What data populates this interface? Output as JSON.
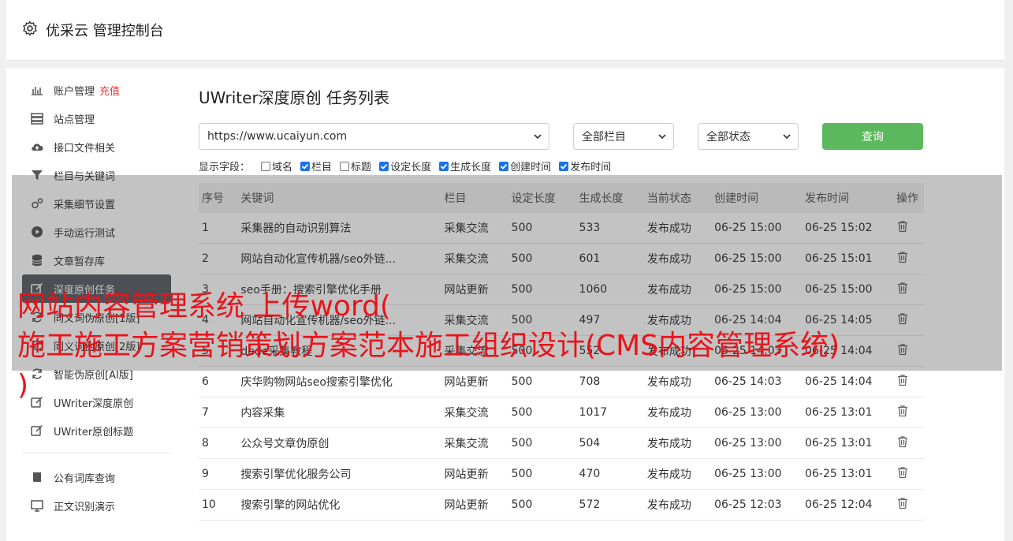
{
  "header": {
    "title": "优采云 管理控制台"
  },
  "sidebar": {
    "items": [
      {
        "label": "账户管理",
        "badge": "充值",
        "icon": "bar-chart-icon"
      },
      {
        "label": "站点管理",
        "icon": "server-icon"
      },
      {
        "label": "接口文件相关",
        "icon": "cloud-upload-icon"
      },
      {
        "label": "栏目与关键词",
        "icon": "filter-icon"
      },
      {
        "label": "采集细节设置",
        "icon": "cogs-icon"
      },
      {
        "label": "手动运行测试",
        "icon": "play-circle-icon"
      },
      {
        "label": "文章暂存库",
        "icon": "database-icon"
      },
      {
        "label": "深度原创任务",
        "icon": "edit-icon",
        "active": true
      },
      {
        "label": "同义词伪原创[1版]",
        "icon": "refresh-icon"
      },
      {
        "label": "同义词伪原创[2版]",
        "icon": "refresh-icon"
      },
      {
        "label": "智能伪原创[AI版]",
        "icon": "refresh-icon"
      },
      {
        "label": "UWriter深度原创",
        "icon": "edit-icon"
      },
      {
        "label": "UWriter原创标题",
        "icon": "edit-icon"
      }
    ],
    "items2": [
      {
        "label": "公有词库查询",
        "icon": "book-icon"
      },
      {
        "label": "正文识别演示",
        "icon": "monitor-icon"
      }
    ]
  },
  "main": {
    "title": "UWriter深度原创 任务列表",
    "site_select": "https://www.ucaiyun.com",
    "column_select": "全部栏目",
    "status_select": "全部状态",
    "query_label": "查询",
    "fields_label": "显示字段：",
    "fields": [
      {
        "label": "域名",
        "checked": false
      },
      {
        "label": "栏目",
        "checked": true
      },
      {
        "label": "标题",
        "checked": false
      },
      {
        "label": "设定长度",
        "checked": true
      },
      {
        "label": "生成长度",
        "checked": true
      },
      {
        "label": "创建时间",
        "checked": true
      },
      {
        "label": "发布时间",
        "checked": true
      }
    ],
    "columns": [
      "序号",
      "关键词",
      "栏目",
      "设定长度",
      "生成长度",
      "当前状态",
      "创建时间",
      "发布时间",
      "操作"
    ],
    "rows": [
      [
        "1",
        "采集器的自动识别算法",
        "采集交流",
        "500",
        "533",
        "发布成功",
        "06-25 15:00",
        "06-25 15:02"
      ],
      [
        "2",
        "网站自动化宣传机器/seo外链...",
        "采集交流",
        "500",
        "601",
        "发布成功",
        "06-25 15:00",
        "06-25 15:01"
      ],
      [
        "3",
        "seo手册：搜索引擎优化手册",
        "网站更新",
        "500",
        "1060",
        "发布成功",
        "06-25 15:00",
        "06-25 15:00"
      ],
      [
        "4",
        "网站自动化宣传机器/seo外链...",
        "采集交流",
        "500",
        "497",
        "发布成功",
        "06-25 14:04",
        "06-25 14:05"
      ],
      [
        "5",
        "dede采集教程",
        "采集交流",
        "500",
        "552",
        "发布成功",
        "06-25 14:03",
        "06-25 14:04"
      ],
      [
        "6",
        "庆华购物网站seo搜索引擎优化",
        "网站更新",
        "500",
        "708",
        "发布成功",
        "06-25 14:03",
        "06-25 14:04"
      ],
      [
        "7",
        "内容采集",
        "采集交流",
        "500",
        "1017",
        "发布成功",
        "06-25 13:00",
        "06-25 13:01"
      ],
      [
        "8",
        "公众号文章伪原创",
        "采集交流",
        "500",
        "504",
        "发布成功",
        "06-25 13:00",
        "06-25 13:01"
      ],
      [
        "9",
        "搜索引擎优化服务公司",
        "网站更新",
        "500",
        "470",
        "发布成功",
        "06-25 13:00",
        "06-25 13:01"
      ],
      [
        "10",
        "搜索引擎的网站优化",
        "网站更新",
        "500",
        "572",
        "发布成功",
        "06-25 12:03",
        "06-25 12:04"
      ]
    ]
  },
  "overlay": {
    "lines": [
      "网站内容管理系统 上传word(",
      "施工施工方案营销策划方案范本施工组织设计(CMS内容管理系统)",
      ")"
    ]
  },
  "colors": {
    "accent_green": "#5cb85c",
    "status_green": "#2e9d2e",
    "overlay_red": "#e8141b",
    "badge_red": "#e53935"
  }
}
